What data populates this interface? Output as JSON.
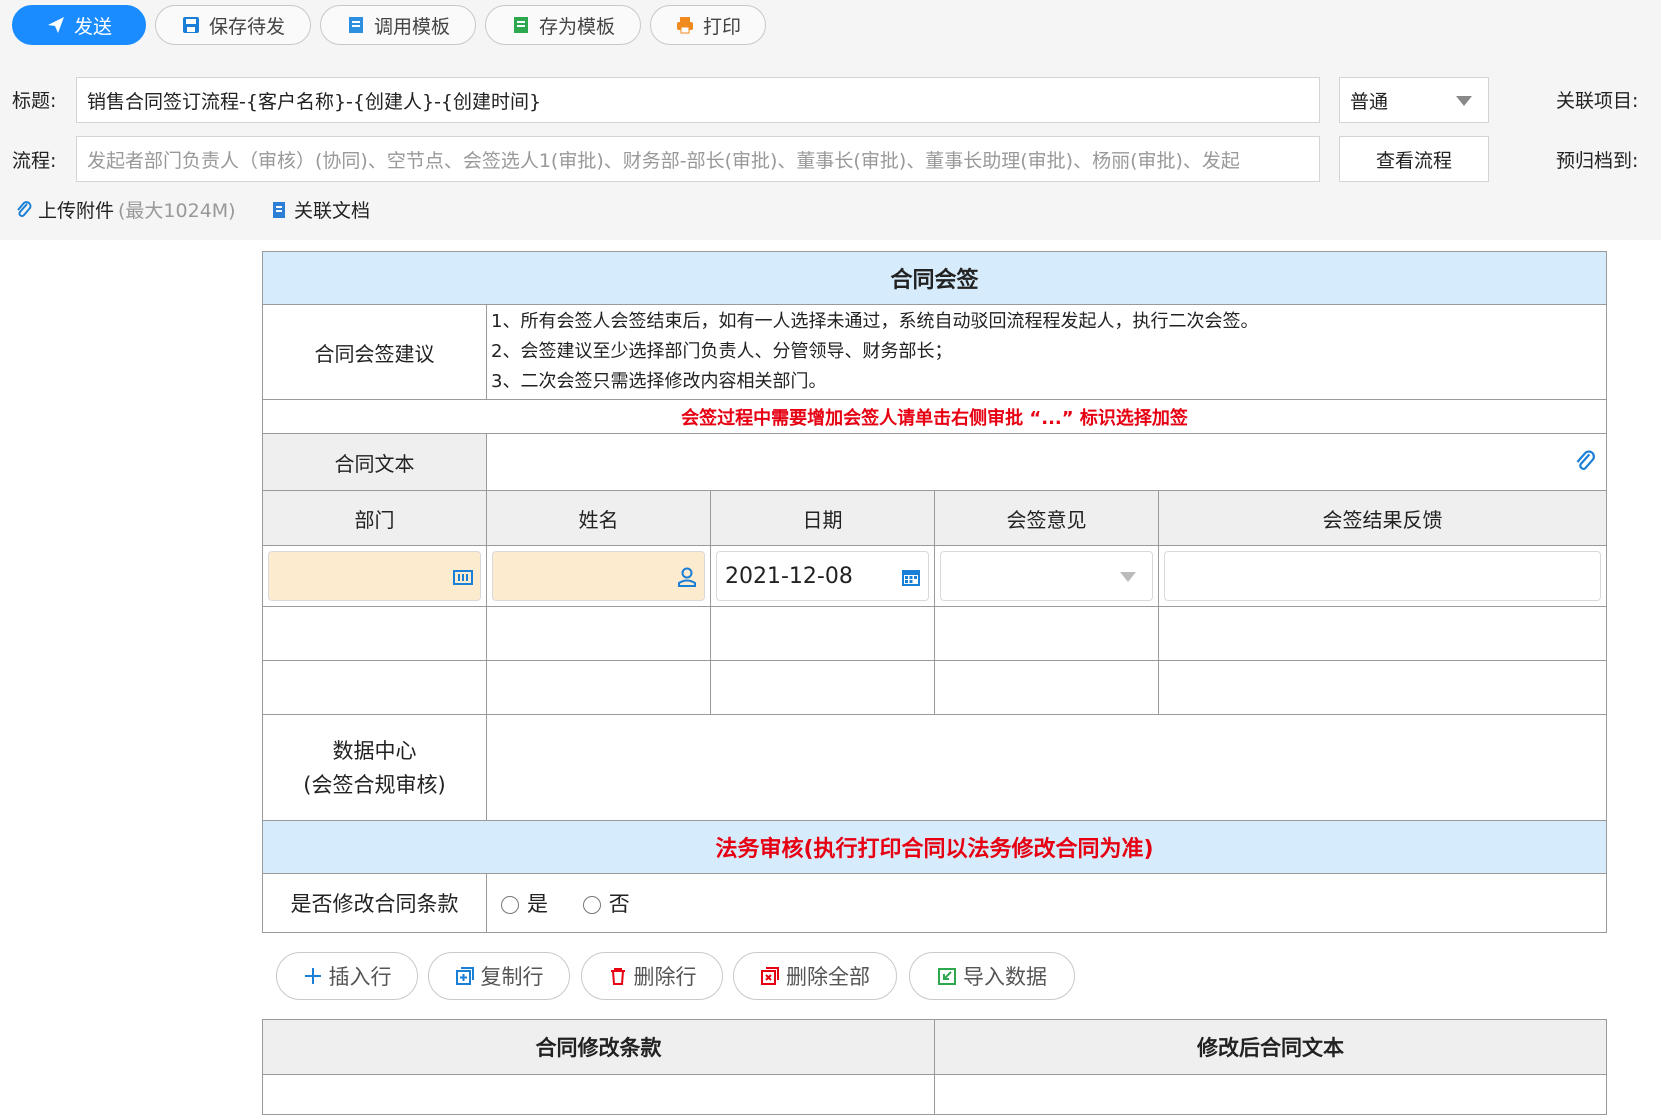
{
  "toolbar": {
    "send": "发送",
    "save_draft": "保存待发",
    "load_template": "调用模板",
    "save_template": "存为模板",
    "print": "打印"
  },
  "form_header": {
    "title_label": "标题:",
    "title_value": "销售合同签订流程-{客户名称}-{创建人}-{创建时间}",
    "priority_value": "普通",
    "related_project_label": "关联项目:",
    "flow_label": "流程:",
    "flow_value": "发起者部门负责人（审核）(协同)、空节点、会签选人1(审批)、财务部-部长(审批)、董事长(审批)、董事长助理(审批)、杨丽(审批)、发起",
    "view_flow_button": "查看流程",
    "archive_label": "预归档到:",
    "upload_label": "上传附件",
    "upload_hint": "(最大1024M)",
    "related_doc_label": "关联文档"
  },
  "form": {
    "section_title": "合同会签",
    "advice_label": "合同会签建议",
    "advice_lines": [
      "1、所有会签人会签结束后，如有一人选择未通过，系统自动驳回流程程发起人，执行二次会签。",
      "2、会签建议至少选择部门负责人、分管领导、财务部长；",
      "3、二次会签只需选择修改内容相关部门。"
    ],
    "red_notice": "会签过程中需要增加会签人请单击右侧审批 “...” 标识选择加签",
    "contract_text_label": "合同文本",
    "columns": [
      "部门",
      "姓名",
      "日期",
      "会签意见",
      "会签结果反馈"
    ],
    "date_value": "2021-12-08",
    "data_center_label_1": "数据中心",
    "data_center_label_2": "(会签合规审核)",
    "legal_title": "法务审核(执行打印合同以法务修改合同为准)",
    "modify_label": "是否修改合同条款",
    "option_yes": "是",
    "option_no": "否"
  },
  "row_actions": {
    "insert": "插入行",
    "copy": "复制行",
    "delete": "删除行",
    "delete_all": "删除全部",
    "import": "导入数据"
  },
  "bottom_table": {
    "col1": "合同修改条款",
    "col2": "修改后合同文本"
  },
  "colors": {
    "primary": "#1a8cff",
    "header_blue": "#d6ebfb",
    "alert_red": "#e60012",
    "input_yellow": "#fdebd0"
  }
}
